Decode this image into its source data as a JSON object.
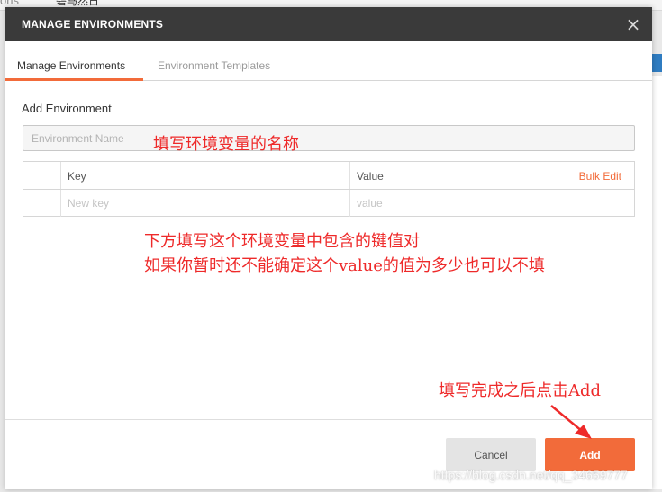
{
  "background": {
    "left_text": "ons",
    "mid_text": "碧马然日"
  },
  "modal": {
    "title": "MANAGE ENVIRONMENTS",
    "close_label": "×",
    "tabs": [
      {
        "label": "Manage Environments",
        "active": true
      },
      {
        "label": "Environment Templates",
        "active": false
      }
    ],
    "section_title": "Add Environment",
    "name_input": {
      "placeholder": "Environment Name",
      "value": ""
    },
    "table": {
      "headers": {
        "key": "Key",
        "value": "Value",
        "bulk_edit": "Bulk Edit"
      },
      "new_row": {
        "key_placeholder": "New key",
        "value_placeholder": "value"
      }
    },
    "buttons": {
      "cancel": "Cancel",
      "add": "Add"
    }
  },
  "annotations": {
    "name_hint": "填写环境变量的名称",
    "kv_hint_line1": "下方填写这个环境变量中包含的键值对",
    "kv_hint_line2": "如果你暂时还不能确定这个value的值为多少也可以不填",
    "add_hint": "填写完成之后点击Add"
  },
  "watermark": "https://blog.csdn.net/qq_34659777",
  "colors": {
    "accent": "#f26b3a",
    "header_bg": "#3a3a3a",
    "annotation": "#ee2a2a"
  }
}
